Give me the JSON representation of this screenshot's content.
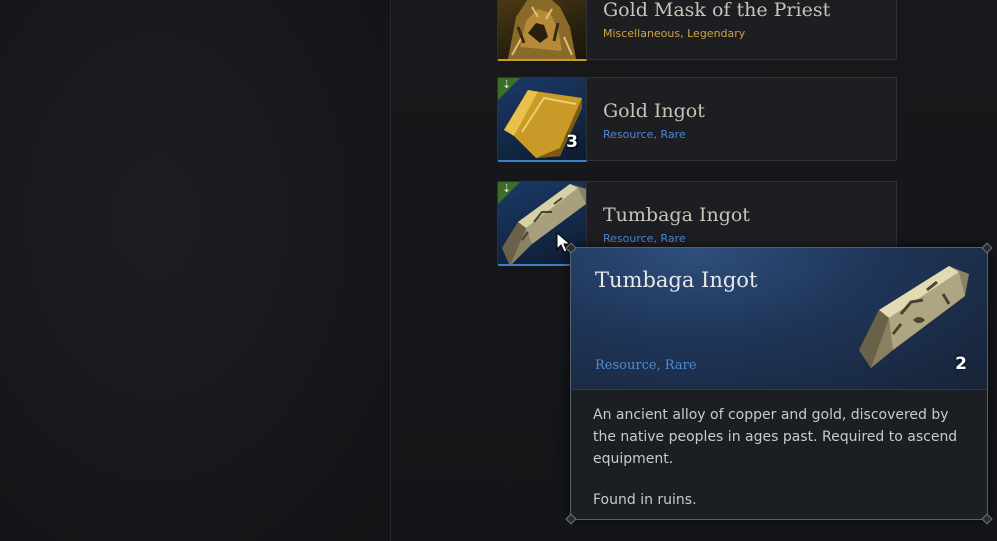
{
  "inventory": {
    "items": [
      {
        "name": "Gold Mask of the Priest",
        "type": "Miscellaneous, Legendary",
        "icon": "gold-mask-icon"
      },
      {
        "name": "Gold Ingot",
        "type": "Resource, Rare",
        "quantity": "3",
        "icon": "gold-ingot-icon",
        "flag_icon": "scrap-icon"
      },
      {
        "name": "Tumbaga Ingot",
        "type": "Resource, Rare",
        "icon": "tumbaga-ingot-icon",
        "flag_icon": "scrap-icon"
      }
    ]
  },
  "tooltip": {
    "title": "Tumbaga Ingot",
    "type": "Resource, Rare",
    "quantity": "2",
    "description": "An ancient alloy of copper and gold, discovered by the native peoples in ages past. Required to ascend equipment.",
    "found": "Found in ruins.",
    "icon": "tumbaga-ingot-icon"
  },
  "colors": {
    "legendary": "#d3a33e",
    "rare": "#4f86d4",
    "tooltip_header": "#1f3558",
    "flag_green": "#3c6e2a"
  }
}
